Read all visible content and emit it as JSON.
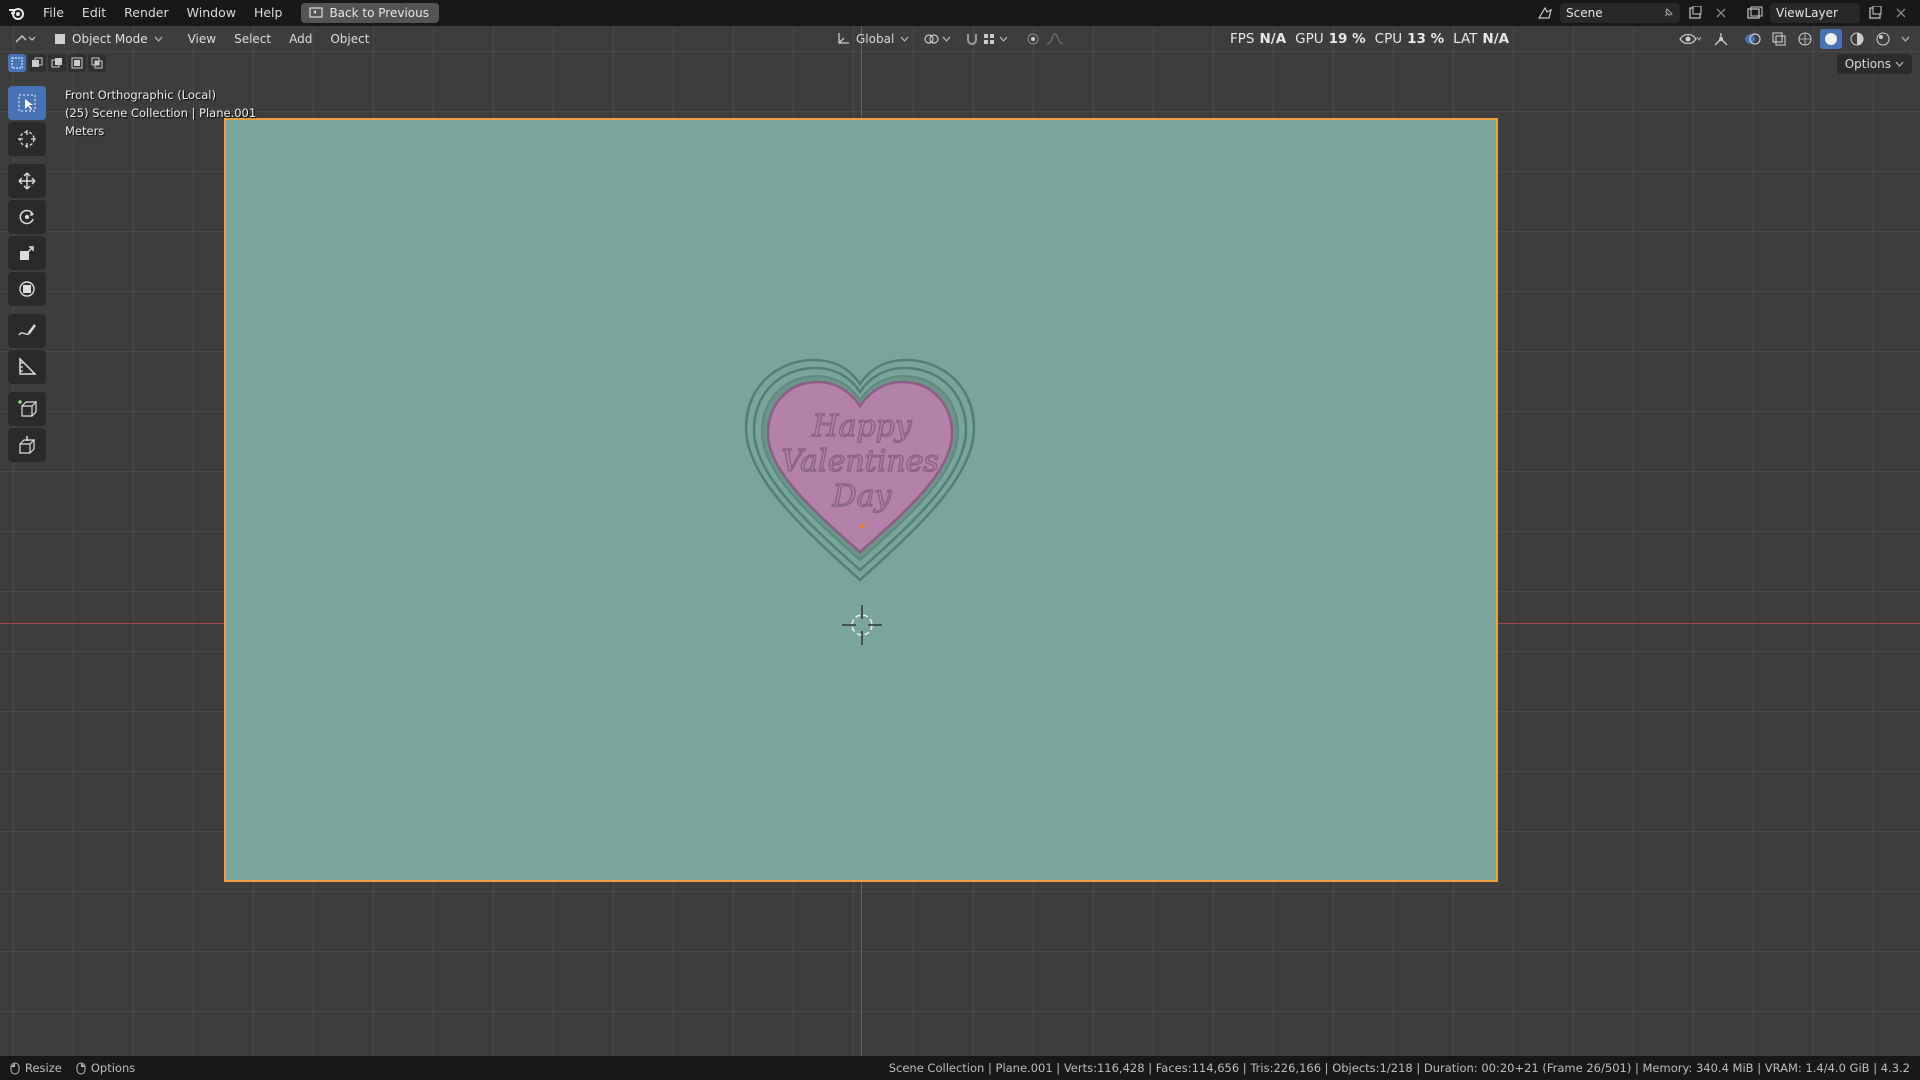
{
  "menubar": {
    "items": [
      "File",
      "Edit",
      "Render",
      "Window",
      "Help"
    ],
    "back_button": "Back to Previous"
  },
  "top_right": {
    "scene": "Scene",
    "view_layer": "ViewLayer"
  },
  "viewport_header": {
    "mode": "Object Mode",
    "menus": [
      "View",
      "Select",
      "Add",
      "Object"
    ],
    "orientation": "Global",
    "stats": {
      "fps_label": "FPS",
      "fps_value": "N/A",
      "gpu_label": "GPU",
      "gpu_value": "19 %",
      "cpu_label": "CPU",
      "cpu_value": "13 %",
      "lat_label": "LAT",
      "lat_value": "N/A"
    },
    "options": "Options"
  },
  "viewport_info": {
    "view": "Front Orthographic (Local)",
    "collection": "(25) Scene Collection | Plane.001",
    "units": "Meters"
  },
  "heart_text": [
    "Happy",
    "Valentines",
    "Day"
  ],
  "statusbar": {
    "left": [
      "Resize",
      "Options"
    ],
    "right": "Scene Collection | Plane.001 | Verts:116,428 | Faces:114,656 | Tris:226,166 | Objects:1/218 | Duration: 00:20+21 (Frame 26/501) | Memory: 340.4 MiB | VRAM: 1.4/4.0 GiB | 4.3.2"
  },
  "colors": {
    "plane": "#7aa59a",
    "selection_outline": "#f0a040",
    "heart_fill": "#b482a8",
    "active_tool": "#4772b3"
  }
}
